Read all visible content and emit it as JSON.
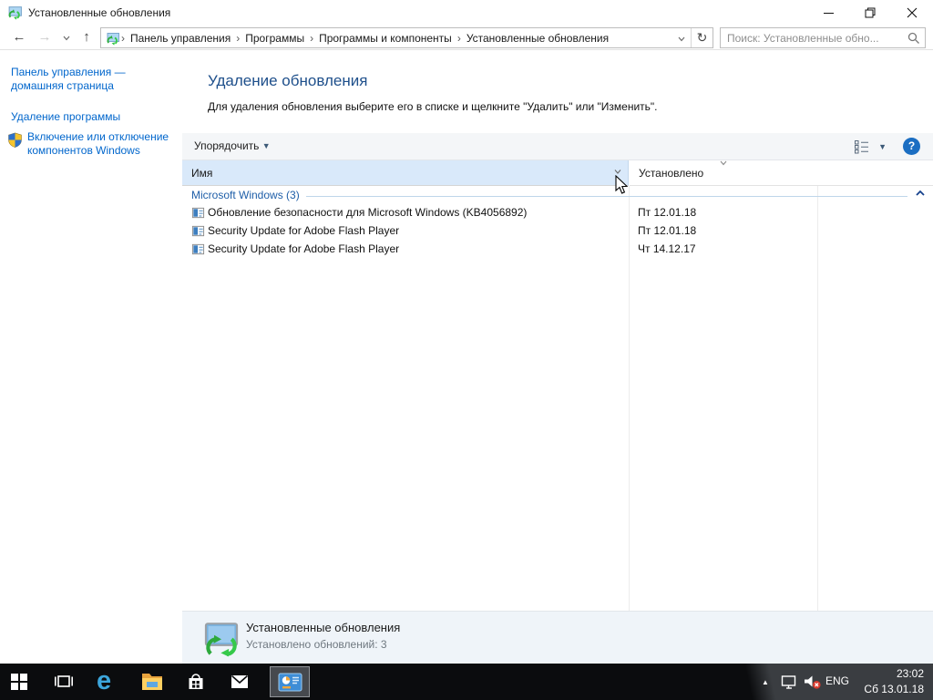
{
  "window": {
    "title": "Установленные обновления"
  },
  "navbar": {
    "breadcrumb": {
      "items": [
        "Панель управления",
        "Программы",
        "Программы и компоненты",
        "Установленные обновления"
      ]
    },
    "search_placeholder": "Поиск: Установленные обно..."
  },
  "sidebar": {
    "items": [
      {
        "label": "Панель управления — домашняя страница"
      },
      {
        "label": "Удаление программы"
      },
      {
        "label": "Включение или отключение компонентов Windows"
      }
    ]
  },
  "main": {
    "heading": "Удаление обновления",
    "instruction": "Для удаления обновления выберите его в списке и щелкните \"Удалить\" или \"Изменить\".",
    "toolbar": {
      "organize": "Упорядочить",
      "help": "?"
    },
    "list": {
      "columns": {
        "name": "Имя",
        "installed": "Установлено"
      },
      "group_label": "Microsoft Windows (3)",
      "rows": [
        {
          "name": "Обновление безопасности для Microsoft Windows (KB4056892)",
          "installed": "Пт 12.01.18"
        },
        {
          "name": "Security Update for Adobe Flash Player",
          "installed": "Пт 12.01.18"
        },
        {
          "name": "Security Update for Adobe Flash Player",
          "installed": "Чт 14.12.17"
        }
      ]
    },
    "details": {
      "title": "Установленные обновления",
      "subtitle": "Установлено обновлений: 3"
    }
  },
  "taskbar": {
    "language": "ENG",
    "time": "23:02",
    "date": "Сб 13.01.18"
  },
  "colors": {
    "link_blue": "#0066CC",
    "heading_blue": "#1E4F8B",
    "group_blue": "#1E5EA8",
    "header_highlight": "#D9E9FA",
    "help_button": "#1B6EC2",
    "details_pane": "#EFF4F9",
    "taskbar_bg": "#0B0C0E",
    "mute_badge": "#D83B2E"
  }
}
